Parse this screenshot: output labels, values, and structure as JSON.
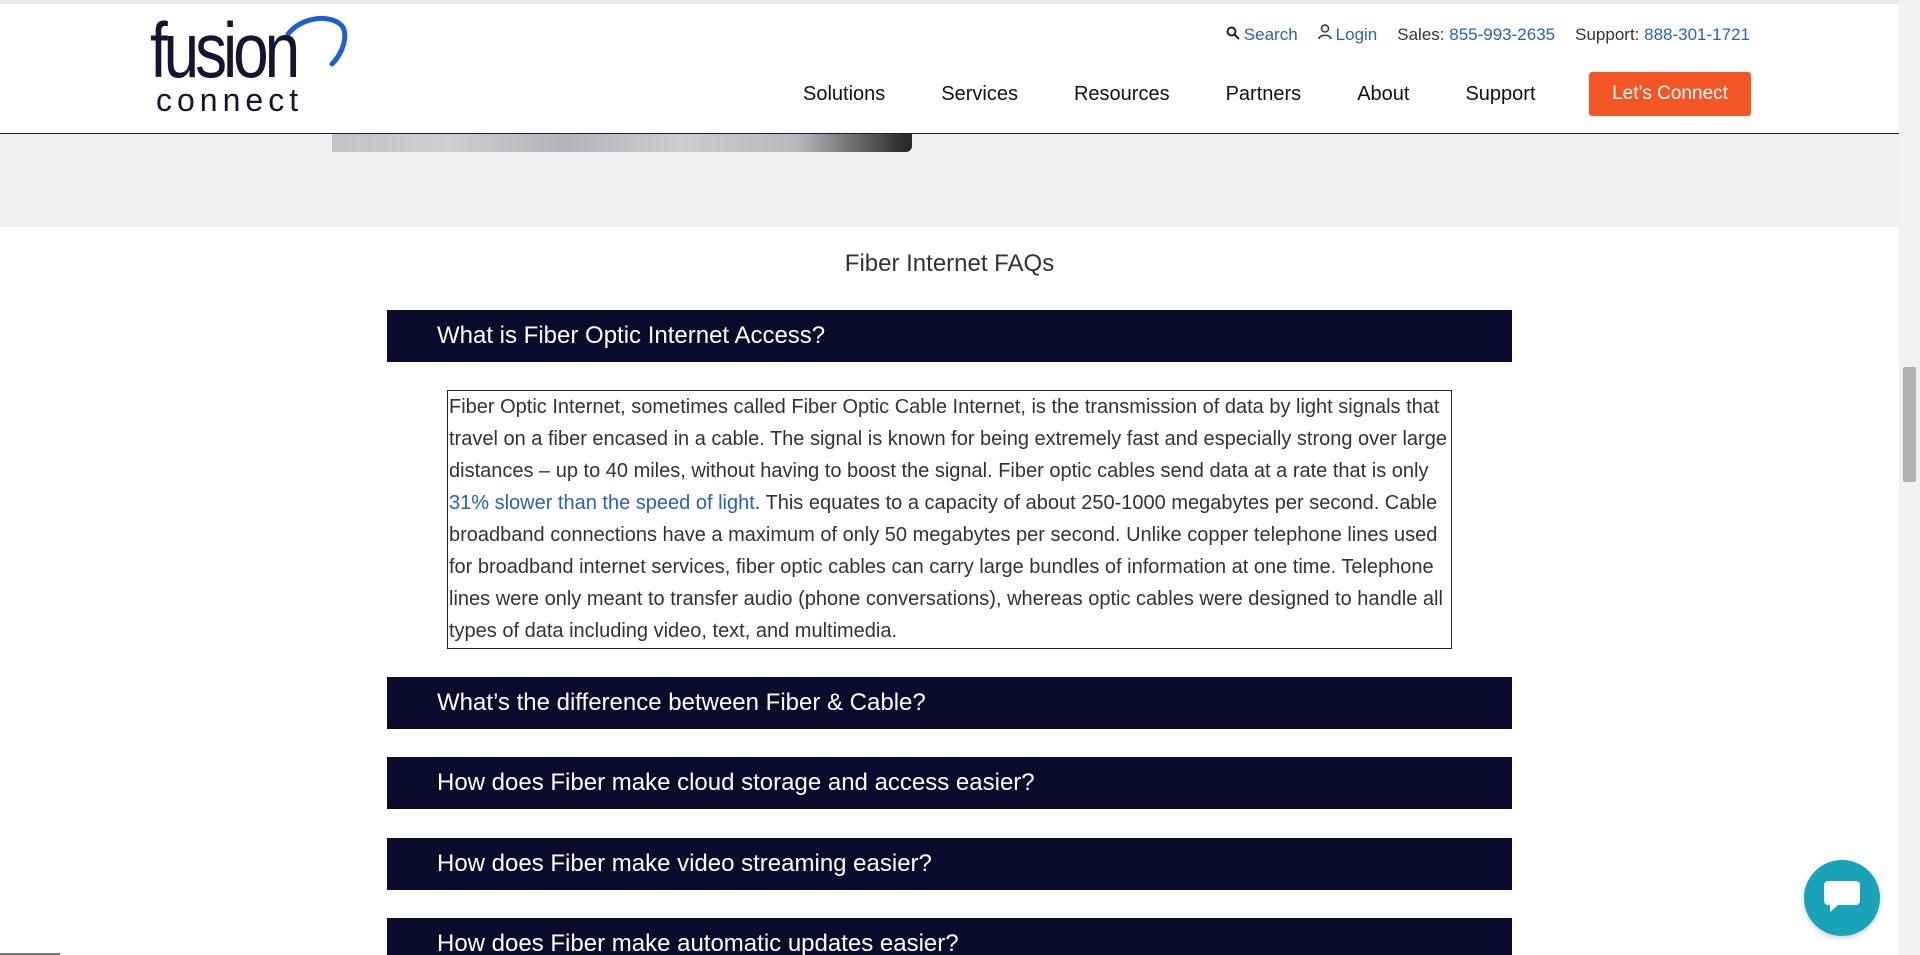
{
  "header": {
    "logo_main": "fusion",
    "logo_sub": "connect",
    "utility": {
      "search_label": "Search",
      "login_label": "Login",
      "sales_prefix": "Sales:",
      "sales_phone": "855-993-2635",
      "support_prefix": "Support:",
      "support_phone": "888-301-1721"
    },
    "nav": [
      {
        "label": "Solutions"
      },
      {
        "label": "Services"
      },
      {
        "label": "Resources"
      },
      {
        "label": "Partners"
      },
      {
        "label": "About"
      },
      {
        "label": "Support"
      }
    ],
    "cta_label": "Let’s Connect"
  },
  "faq": {
    "title": "Fiber Internet FAQs",
    "items": [
      {
        "question": "What is Fiber Optic Internet Access?"
      },
      {
        "question": "What’s the difference between Fiber & Cable?"
      },
      {
        "question": "How does Fiber make cloud storage and access easier?"
      },
      {
        "question": "How does Fiber make video streaming easier?"
      },
      {
        "question": "How does Fiber make automatic updates easier?"
      }
    ],
    "answer": {
      "before_link": "Fiber Optic Internet, sometimes called Fiber Optic Cable Internet, is the transmission of data by light signals that travel on a fiber encased in a cable. The signal is known for being extremely fast and especially strong over large distances – up to 40 miles, without having to boost the signal. Fiber optic cables send data at a rate that is only ",
      "link_text": "31% slower than the speed of light",
      "after_link": ". This equates to a capacity of about 250-1000 megabytes per second. Cable broadband connections have a maximum of only 50 megabytes per second. Unlike copper telephone lines used for broadband internet services, fiber optic cables can carry large bundles of information at one time. Telephone lines were only meant to transfer audio (phone conversations), whereas optic cables were designed to handle all types of data including video, text, and multimedia."
    }
  },
  "colors": {
    "navy": "#0b0b2e",
    "cta_orange": "#f35625",
    "link_blue": "#2563b8",
    "chat_teal": "#1aa3b8"
  },
  "icons": {
    "search": "search-icon",
    "login": "user-icon",
    "chat": "chat-bubble-icon"
  }
}
